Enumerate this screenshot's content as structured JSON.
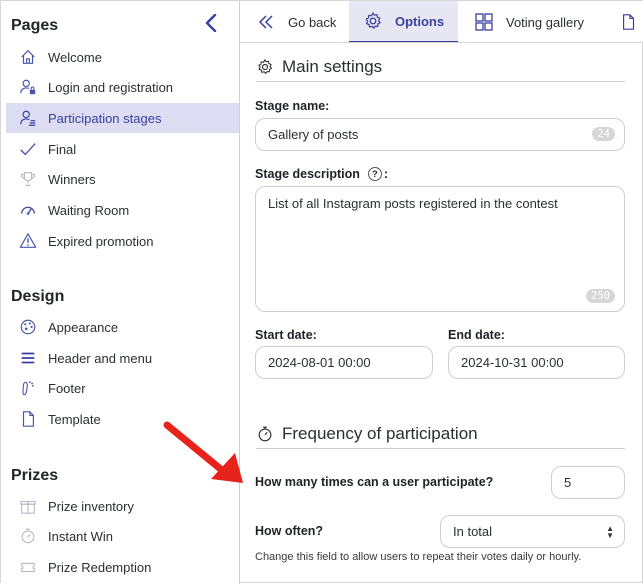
{
  "sidebar": {
    "pages_title": "Pages",
    "pages": [
      {
        "label": "Welcome",
        "icon": "home-icon"
      },
      {
        "label": "Login and registration",
        "icon": "user-lock-icon"
      },
      {
        "label": "Participation stages",
        "icon": "user-stages-icon",
        "active": true
      },
      {
        "label": "Final",
        "icon": "check-icon"
      },
      {
        "label": "Winners",
        "icon": "trophy-icon"
      },
      {
        "label": "Waiting Room",
        "icon": "gauge-icon"
      },
      {
        "label": "Expired promotion",
        "icon": "warning-icon"
      }
    ],
    "design_title": "Design",
    "design": [
      {
        "label": "Appearance",
        "icon": "palette-icon"
      },
      {
        "label": "Header and menu",
        "icon": "menu-icon"
      },
      {
        "label": "Footer",
        "icon": "footer-icon"
      },
      {
        "label": "Template",
        "icon": "document-icon"
      }
    ],
    "prizes_title": "Prizes",
    "prizes": [
      {
        "label": "Prize inventory",
        "icon": "gift-icon"
      },
      {
        "label": "Instant Win",
        "icon": "stopwatch-icon"
      },
      {
        "label": "Prize Redemption",
        "icon": "ticket-icon"
      }
    ]
  },
  "tabs": {
    "go_back": "Go back",
    "options": "Options",
    "voting_gallery": "Voting gallery"
  },
  "main": {
    "section_title": "Main settings",
    "stage_name_label": "Stage name:",
    "stage_name_value": "Gallery of posts",
    "stage_name_counter": "24",
    "stage_description_label": "Stage description",
    "stage_description_suffix": ":",
    "help_glyph": "?",
    "stage_description_value": "List of all Instagram posts registered in the contest",
    "stage_description_counter": "250",
    "start_date_label": "Start date:",
    "start_date_value": "2024-08-01 00:00",
    "end_date_label": "End date:",
    "end_date_value": "2024-10-31 00:00",
    "frequency_title": "Frequency of participation",
    "times_label": "How many times can a user participate?",
    "times_value": "5",
    "how_often_label": "How often?",
    "how_often_value": "In total",
    "how_often_help": "Change this field to allow users to repeat their votes daily or hourly."
  },
  "colors": {
    "accent": "#3a3fa0",
    "active_bg": "#dcdcf3",
    "annotation_arrow": "#e8231b"
  }
}
